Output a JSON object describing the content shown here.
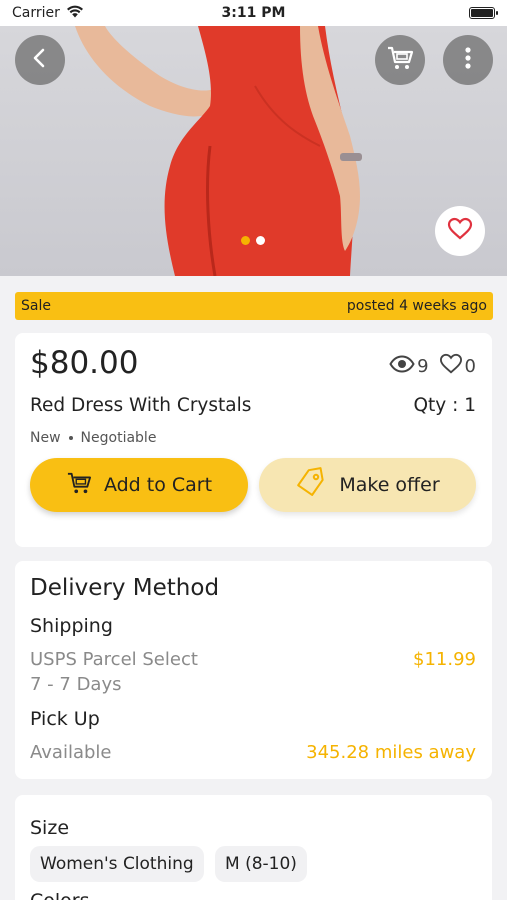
{
  "status_bar": {
    "carrier": "Carrier",
    "time": "3:11 PM"
  },
  "gallery": {
    "image_count": 2,
    "active_index": 0,
    "dress_color": "#e03a2a"
  },
  "listing": {
    "badge": "Sale",
    "posted": "posted 4 weeks ago"
  },
  "product": {
    "price": "$80.00",
    "views": "9",
    "likes": "0",
    "title": "Red Dress With Crystals",
    "qty": "Qty : 1",
    "condition": "New",
    "negotiable": "Negotiable"
  },
  "actions": {
    "add_to_cart": "Add to Cart",
    "make_offer": "Make offer"
  },
  "delivery": {
    "heading": "Delivery Method",
    "shipping_label": "Shipping",
    "shipping_carrier": "USPS Parcel Select",
    "shipping_days": "7 - 7 Days",
    "shipping_price": "$11.99",
    "pickup_label": "Pick Up",
    "pickup_status": "Available",
    "pickup_distance": "345.28 miles away"
  },
  "size": {
    "heading": "Size",
    "category": "Women's Clothing",
    "value": "M (8-10)"
  },
  "colors": {
    "heading": "Colors"
  },
  "theme": {
    "accent": "#f9bf13",
    "accent_text": "#f5b301",
    "offer_bg": "#f7e6b2"
  }
}
